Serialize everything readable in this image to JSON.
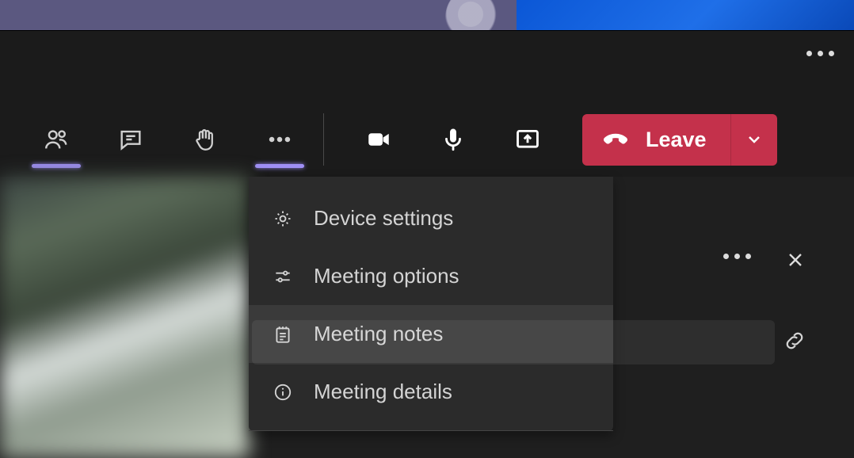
{
  "toolbar": {
    "leave_label": "Leave"
  },
  "menu": {
    "device_settings": "Device settings",
    "meeting_options": "Meeting options",
    "meeting_notes": "Meeting notes",
    "meeting_details": "Meeting details"
  }
}
